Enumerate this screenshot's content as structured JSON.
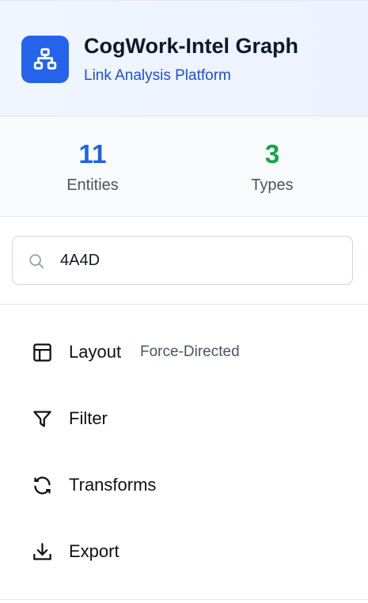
{
  "header": {
    "title": "CogWork-Intel Graph",
    "subtitle": "Link Analysis Platform",
    "logo_icon": "sitemap-icon"
  },
  "stats": [
    {
      "value": "11",
      "label": "Entities",
      "color": "#1d63e0"
    },
    {
      "value": "3",
      "label": "Types",
      "color": "#16a34a"
    }
  ],
  "search": {
    "value": "4A4D",
    "icon": "search-icon"
  },
  "menu": [
    {
      "label": "Layout",
      "detail": "Force-Directed",
      "icon": "layout-icon"
    },
    {
      "label": "Filter",
      "icon": "filter-icon"
    },
    {
      "label": "Transforms",
      "icon": "refresh-icon"
    },
    {
      "label": "Export",
      "icon": "download-icon"
    }
  ]
}
